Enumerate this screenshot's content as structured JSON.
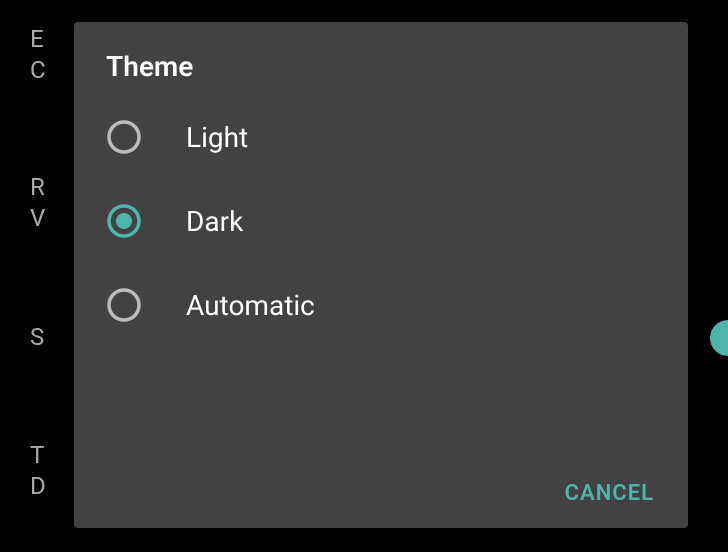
{
  "background": {
    "item1_line1": "E",
    "item1_line2": "C",
    "item2_line1": "R",
    "item2_line2": "V",
    "item3_line1": "S",
    "item4_line1": "T",
    "item4_line2": "D"
  },
  "dialog": {
    "title": "Theme",
    "options": [
      {
        "label": "Light",
        "selected": false
      },
      {
        "label": "Dark",
        "selected": true
      },
      {
        "label": "Automatic",
        "selected": false
      }
    ],
    "cancel_label": "CANCEL"
  },
  "colors": {
    "accent": "#4db6ac",
    "radio_unselected": "#bdbdbd"
  }
}
